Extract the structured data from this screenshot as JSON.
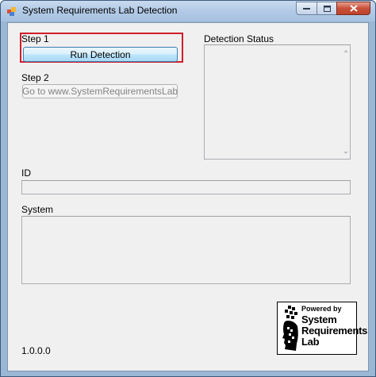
{
  "window": {
    "title": "System Requirements Lab Detection",
    "app_icon": "app-icon",
    "caption_buttons": {
      "minimize_icon": "minimize-icon",
      "maximize_icon": "maximize-icon",
      "close_icon": "close-icon"
    }
  },
  "step1": {
    "label": "Step 1",
    "button_label": "Run Detection",
    "highlight_color": "#d11e2b"
  },
  "step2": {
    "label": "Step 2",
    "button_label": "Go to www.SystemRequirementsLab"
  },
  "detection_status": {
    "label": "Detection Status",
    "value": ""
  },
  "id_field": {
    "label": "ID",
    "value": ""
  },
  "system_field": {
    "label": "System",
    "value": ""
  },
  "version": "1.0.0.0",
  "logo": {
    "powered_by": "Powered by",
    "line1": "System",
    "line2": "Requirements",
    "line3": "Lab",
    "icon": "srl-logo-icon"
  }
}
